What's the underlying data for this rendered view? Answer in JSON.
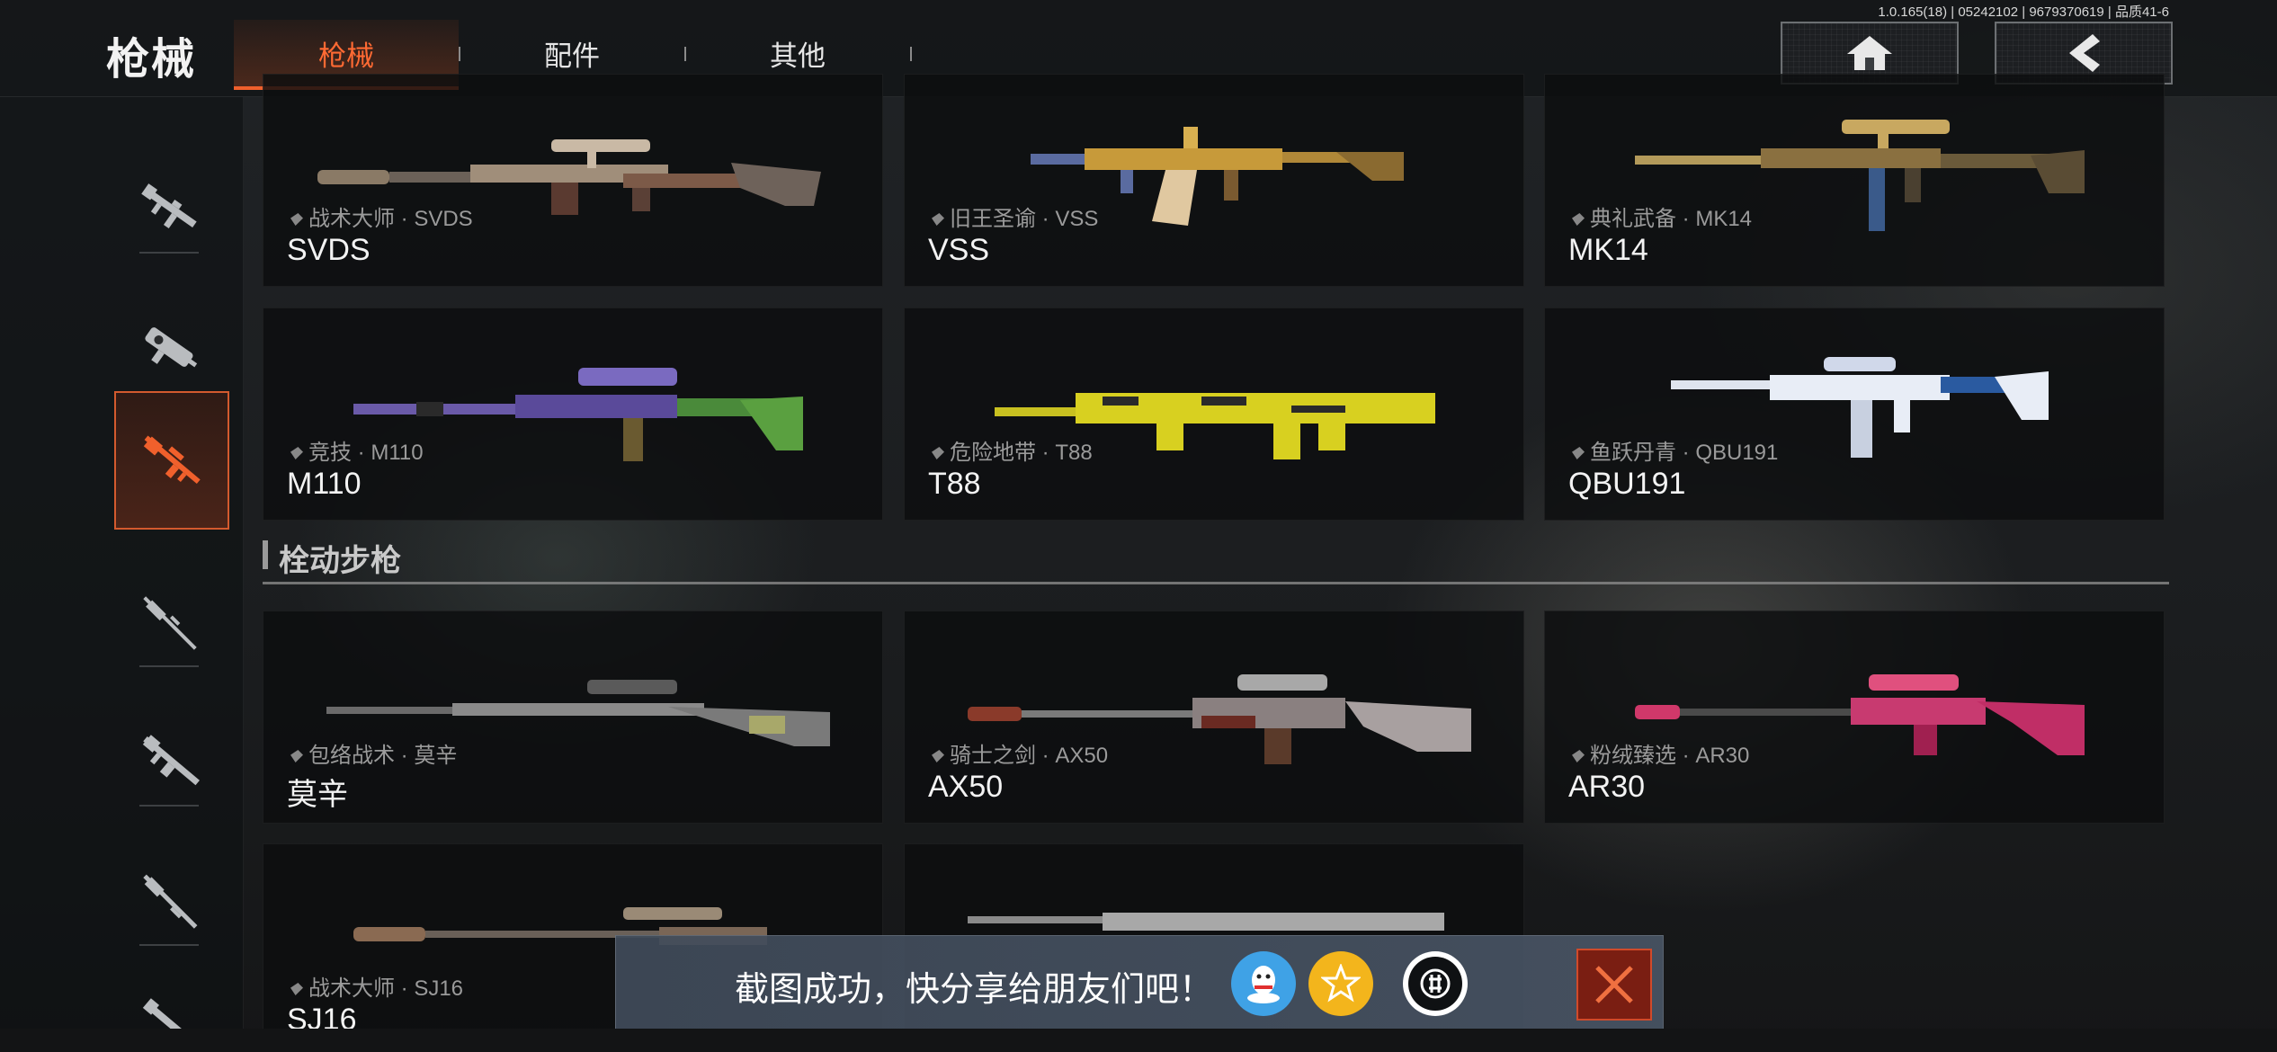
{
  "version": "1.0.165(18) | 05242102 | 9679370619 | 品质41-6",
  "header": {
    "title": "枪械",
    "tabs": [
      {
        "label": "枪械",
        "active": true
      },
      {
        "label": "配件",
        "active": false
      },
      {
        "label": "其他",
        "active": false
      }
    ],
    "home_icon": "home-icon",
    "back_icon": "chevron-left-icon"
  },
  "sidebar": {
    "items": [
      {
        "icon": "assault-rifle-icon",
        "active": false
      },
      {
        "icon": "smg-icon",
        "active": false
      },
      {
        "icon": "marksman-rifle-icon",
        "active": true
      },
      {
        "icon": "bolt-action-rifle-icon",
        "active": false
      },
      {
        "icon": "lmg-icon",
        "active": false
      },
      {
        "icon": "shotgun-icon",
        "active": false
      },
      {
        "icon": "pistol-icon",
        "active": false
      }
    ]
  },
  "cards_top": [
    {
      "skin": "战术大师 · SVDS",
      "name": "SVDS"
    },
    {
      "skin": "旧王圣谕 · VSS",
      "name": "VSS"
    },
    {
      "skin": "典礼武备 · MK14",
      "name": "MK14"
    },
    {
      "skin": "竞技 · M110",
      "name": "M110"
    },
    {
      "skin": "危险地带 · T88",
      "name": "T88"
    },
    {
      "skin": "鱼跃丹青 · QBU191",
      "name": "QBU191"
    }
  ],
  "section": {
    "title": "栓动步枪"
  },
  "cards_bolt": [
    {
      "skin": "包络战术 · 莫辛",
      "name": "莫辛"
    },
    {
      "skin": "骑士之剑 · AX50",
      "name": "AX50"
    },
    {
      "skin": "粉绒臻选 · AR30",
      "name": "AR30"
    },
    {
      "skin": "战术大师 · SJ16",
      "name": "SJ16"
    },
    {
      "skin": "",
      "name": ""
    }
  ],
  "toast": {
    "message": "截图成功，快分享给朋友们吧！",
    "share_targets": [
      "qq-icon",
      "qzone-star-icon",
      "wechat-icon"
    ],
    "close_icon": "close-icon"
  },
  "colors": {
    "accent": "#f0602c",
    "qq_blue": "#3fa2e6",
    "qzone_yellow": "#f3b51c"
  }
}
